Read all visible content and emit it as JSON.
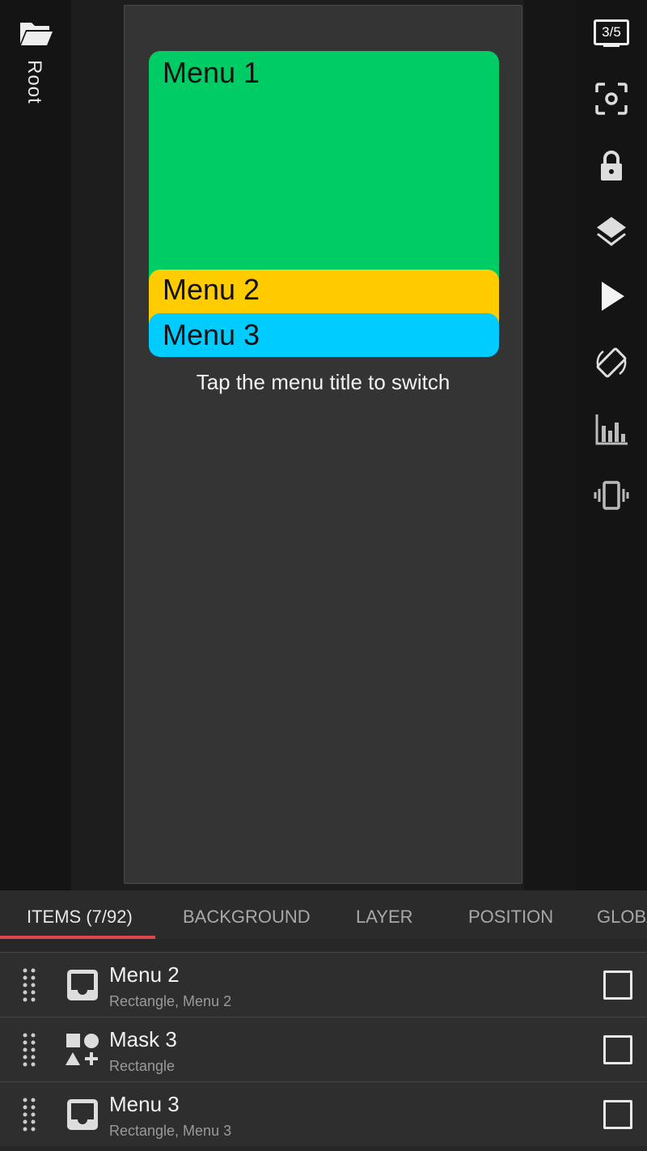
{
  "left_rail": {
    "folder_icon": "folder-open-icon",
    "root_label": "Root"
  },
  "canvas": {
    "menus": [
      {
        "label": "Menu 1",
        "color": "#00cc66"
      },
      {
        "label": "Menu 2",
        "color": "#ffcc00"
      },
      {
        "label": "Menu 3",
        "color": "#00ccff"
      }
    ],
    "hint": "Tap the menu title to switch"
  },
  "right_rail": {
    "page_counter": "3/5",
    "buttons": [
      "screenshot-focus-icon",
      "lock-icon",
      "layers-icon",
      "play-icon",
      "rotate-screen-icon",
      "stats-icon",
      "vibrate-icon"
    ]
  },
  "tabs": [
    {
      "label": "ITEMS (7/92)",
      "active": true
    },
    {
      "label": "BACKGROUND",
      "active": false
    },
    {
      "label": "LAYER",
      "active": false
    },
    {
      "label": "POSITION",
      "active": false
    },
    {
      "label": "GLOBA",
      "active": false
    }
  ],
  "items": [
    {
      "title": "Menu 2",
      "subtitle": "Rectangle, Menu 2",
      "icon": "inbox-icon",
      "checked": false
    },
    {
      "title": "Mask 3",
      "subtitle": "Rectangle",
      "icon": "shapes-icon",
      "checked": false
    },
    {
      "title": "Menu 3",
      "subtitle": "Rectangle, Menu 3",
      "icon": "inbox-icon",
      "checked": false
    }
  ],
  "colors": {
    "accent": "#e0444e",
    "background": "#161616",
    "panel": "#272727"
  }
}
